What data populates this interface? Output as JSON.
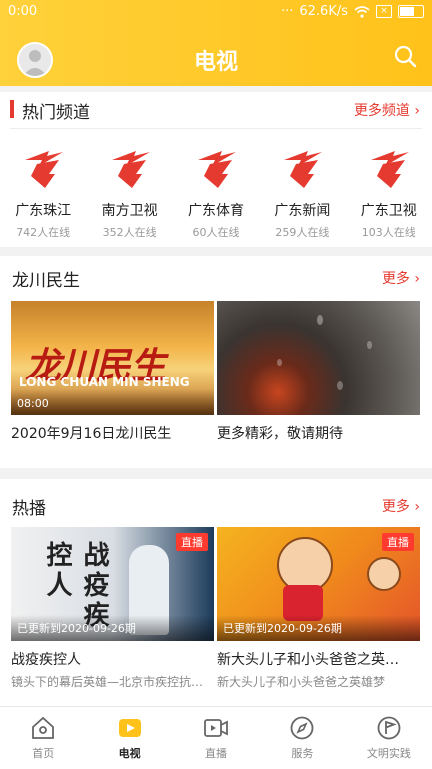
{
  "status": {
    "time": "0:00",
    "speed": "62.6K/s"
  },
  "header": {
    "title": "电视"
  },
  "hot_channels": {
    "title": "热门频道",
    "more": "更多频道 ›",
    "items": [
      {
        "name": "广东珠江",
        "viewers": "742人在线"
      },
      {
        "name": "南方卫视",
        "viewers": "352人在线"
      },
      {
        "name": "广东体育",
        "viewers": "60人在线"
      },
      {
        "name": "广东新闻",
        "viewers": "259人在线"
      },
      {
        "name": "广东卫视",
        "viewers": "103人在线"
      }
    ]
  },
  "longchuan": {
    "title": "龙川民生",
    "more": "更多 ›",
    "cards": [
      {
        "title": "2020年9月16日龙川民生",
        "caption": "08:00",
        "thumb_text": "龙川民生",
        "thumb_sub": "LONG CHUAN MIN SHENG"
      },
      {
        "title": "更多精彩，敬请期待"
      }
    ]
  },
  "hot_play": {
    "title": "热播",
    "more": "更多 ›",
    "cards": [
      {
        "badge": "直播",
        "caption": "已更新到2020-09-26期",
        "title": "战疫疾控人",
        "sub": "镜头下的幕后英雄—北京市疾控抗…",
        "thumb_text": "战疫疾控人"
      },
      {
        "badge": "直播",
        "caption": "已更新到2020-09-26期",
        "title": "新大头儿子和小头爸爸之英…",
        "sub": "新大头儿子和小头爸爸之英雄梦"
      }
    ]
  },
  "tabbar": [
    {
      "label": "首页"
    },
    {
      "label": "电视"
    },
    {
      "label": "直播"
    },
    {
      "label": "服务"
    },
    {
      "label": "文明实践"
    }
  ]
}
